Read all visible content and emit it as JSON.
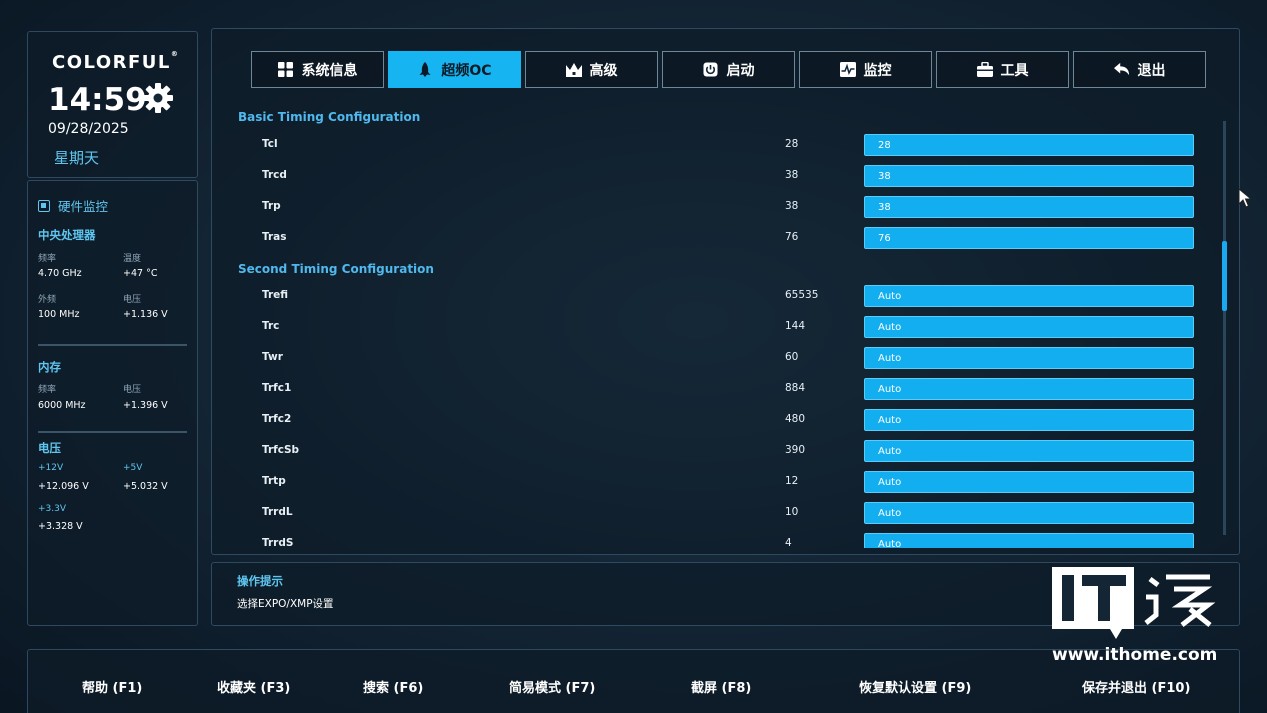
{
  "brand": {
    "logo": "COLORFUL",
    "reg": "®",
    "time": "14:59",
    "date": "09/28/2025",
    "weekday": "星期天"
  },
  "hardware": {
    "title": "硬件监控",
    "cpu": {
      "title": "中央处理器",
      "freq_label": "频率",
      "freq": "4.70 GHz",
      "temp_label": "温度",
      "temp": "+47 °C",
      "bclk_label": "外频",
      "bclk": "100 MHz",
      "volt_label": "电压",
      "volt": "+1.136 V"
    },
    "memory": {
      "title": "内存",
      "freq_label": "频率",
      "freq": "6000 MHz",
      "volt_label": "电压",
      "volt": "+1.396 V"
    },
    "voltage": {
      "title": "电压",
      "v12_label": "+12V",
      "v12": "+12.096 V",
      "v5_label": "+5V",
      "v5": "+5.032 V",
      "v33_label": "+3.3V",
      "v33": "+3.328 V"
    }
  },
  "tabs": [
    {
      "label": "系统信息",
      "icon": "grid-icon",
      "active": false
    },
    {
      "label": "超频OC",
      "icon": "rocket-icon",
      "active": true
    },
    {
      "label": "高级",
      "icon": "crown-icon",
      "active": false
    },
    {
      "label": "启动",
      "icon": "power-icon",
      "active": false
    },
    {
      "label": "监控",
      "icon": "monitor-icon",
      "active": false
    },
    {
      "label": "工具",
      "icon": "toolbox-icon",
      "active": false
    },
    {
      "label": "退出",
      "icon": "exit-arrow-icon",
      "active": false
    }
  ],
  "groups": {
    "basic": {
      "title": "Basic Timing Configuration",
      "rows": [
        {
          "label": "Tcl",
          "value": "28",
          "setting": "28"
        },
        {
          "label": "Trcd",
          "value": "38",
          "setting": "38"
        },
        {
          "label": "Trp",
          "value": "38",
          "setting": "38"
        },
        {
          "label": "Tras",
          "value": "76",
          "setting": "76"
        }
      ]
    },
    "second": {
      "title": "Second Timing Configuration",
      "rows": [
        {
          "label": "Trefi",
          "value": "65535",
          "setting": "Auto"
        },
        {
          "label": "Trc",
          "value": "144",
          "setting": "Auto"
        },
        {
          "label": "Twr",
          "value": "60",
          "setting": "Auto"
        },
        {
          "label": "Trfc1",
          "value": "884",
          "setting": "Auto"
        },
        {
          "label": "Trfc2",
          "value": "480",
          "setting": "Auto"
        },
        {
          "label": "TrfcSb",
          "value": "390",
          "setting": "Auto"
        },
        {
          "label": "Trtp",
          "value": "12",
          "setting": "Auto"
        },
        {
          "label": "TrrdL",
          "value": "10",
          "setting": "Auto"
        },
        {
          "label": "TrrdS",
          "value": "4",
          "setting": "Auto"
        }
      ]
    }
  },
  "hint": {
    "title": "操作提示",
    "text": "选择EXPO/XMP设置"
  },
  "footer": [
    {
      "label": "帮助 (F1)"
    },
    {
      "label": "收藏夹 (F3)"
    },
    {
      "label": "搜索 (F6)"
    },
    {
      "label": "简易模式 (F7)"
    },
    {
      "label": "截屏 (F8)"
    },
    {
      "label": "恢复默认设置 (F9)"
    },
    {
      "label": "保存并退出 (F10)"
    }
  ],
  "watermark": {
    "text": "IT之家",
    "url": "www.ithome.com"
  },
  "colors": {
    "accent": "#12aef0",
    "panel": "#0e1c28",
    "label_blue": "#5fc6f0"
  }
}
